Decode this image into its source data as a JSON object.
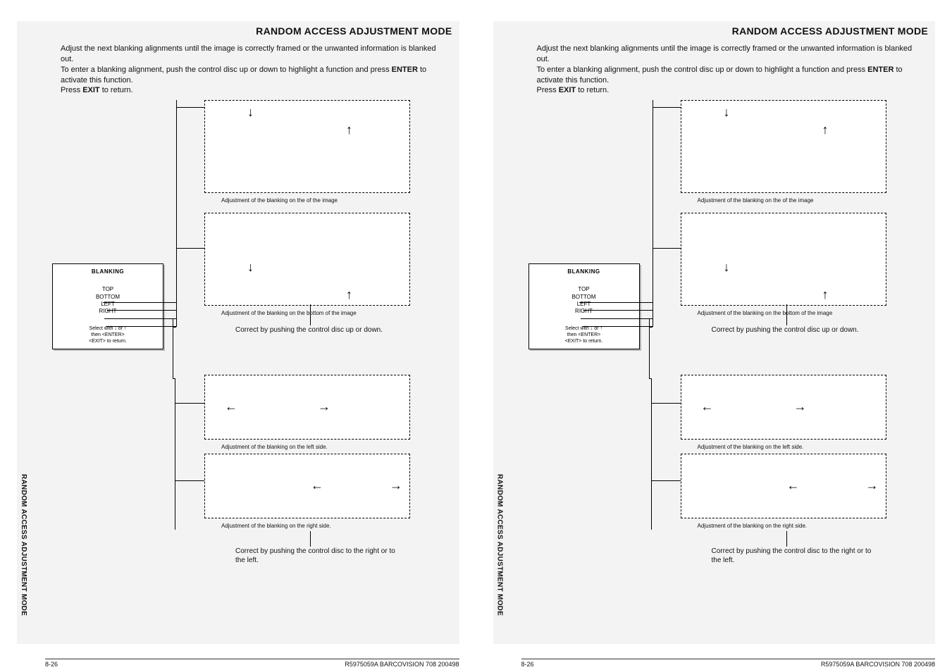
{
  "pageTitle": "RANDOM ACCESS ADJUSTMENT MODE",
  "intro": {
    "line1": "Adjust the next blanking alignments until the image is correctly framed or the unwanted information is blanked out.",
    "line2a": "To enter a blanking alignment, push the control disc up or down to highlight a function and press ",
    "line2b": "ENTER",
    "line2c": " to activate this function.",
    "line3a": "Press ",
    "line3b": "EXIT",
    "line3c": " to return."
  },
  "menu": {
    "title": "BLANKING",
    "items": [
      "TOP",
      "BOTTOM",
      "LEFT",
      "RIGHT"
    ],
    "foot1": "Select with  ↓ or ↑",
    "foot2": "then  <ENTER>",
    "foot3": "<EXIT>  to return."
  },
  "captions": {
    "top": "Adjustment of the blanking on the of the image",
    "bottom": "Adjustment of the blanking on the bottom of the image",
    "left": "Adjustment of the blanking on the left side.",
    "right": "Adjustment of the blanking on the right side."
  },
  "instructions": {
    "vert": "Correct by pushing the control disc up or down.",
    "horiz": "Correct by pushing the control disc to the right or to the left."
  },
  "arrows": {
    "down": "↓",
    "up": "↑",
    "left": "←",
    "right": "→"
  },
  "sideText": "RANDOM ACCESS ADJUSTMENT MODE",
  "footer": {
    "pageNum": "8-26",
    "docRef": "R5975059A BARCOVISION 708  200498"
  }
}
